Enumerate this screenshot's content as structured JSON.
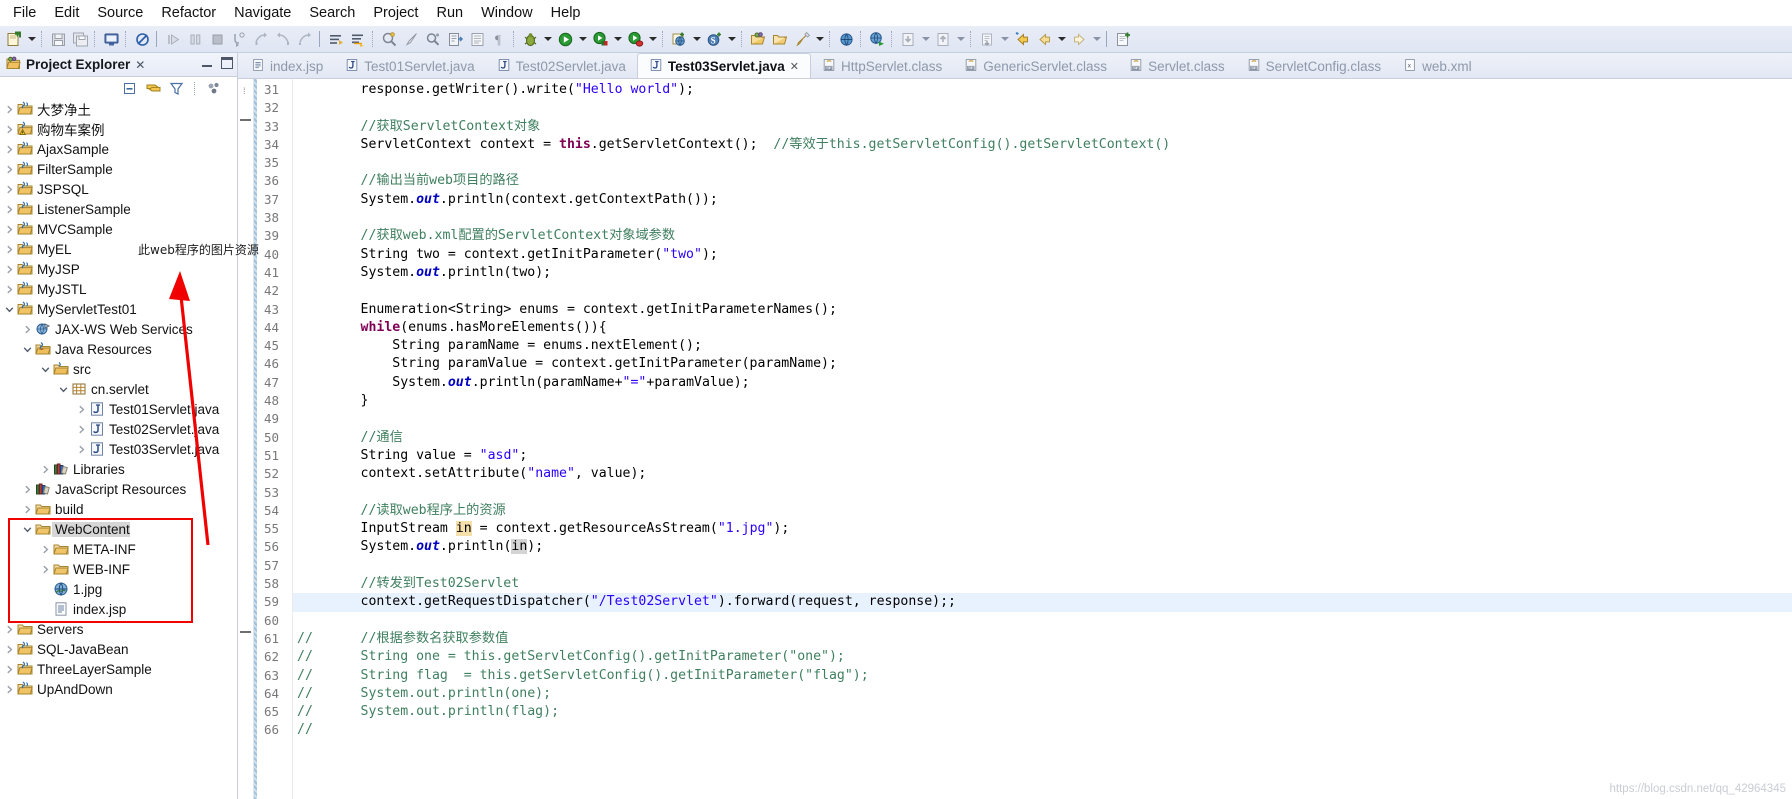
{
  "menubar": {
    "items": [
      "File",
      "Edit",
      "Source",
      "Refactor",
      "Navigate",
      "Search",
      "Project",
      "Run",
      "Window",
      "Help"
    ]
  },
  "toolbar": {
    "icons": [
      "new-file-icon",
      "new-file-dropdown-icon",
      "save-icon",
      "save-all-icon",
      "console-icon",
      "skip-breakpoints-icon",
      "resume-icon",
      "suspend-icon",
      "terminate-icon",
      "step-into-icon",
      "step-over-icon",
      "step-return-icon",
      "drop-to-frame-icon",
      "next-annotation-icon",
      "previous-annotation-icon",
      "open-type-icon",
      "brush-icon",
      "search-icon",
      "export-icon",
      "outline-icon",
      "paragraph-icon",
      "debug-icon",
      "debug-dropdown-icon",
      "run-icon",
      "run-dropdown-icon",
      "run-as-server-icon",
      "run-as-dropdown-icon",
      "profile-icon",
      "profile-dropdown-icon",
      "new-web-project-icon",
      "new-web-dropdown-icon",
      "new-spring-icon",
      "new-spring-dropdown-icon",
      "open-perspective-icon",
      "open-folder-icon",
      "pencil-icon",
      "pencil-dropdown-icon",
      "globe-icon",
      "web-browser-icon",
      "import-icon",
      "import-dropdown-icon",
      "export2-icon",
      "export2-dropdown-icon",
      "back-history-icon",
      "back-icon",
      "back-dropdown-icon",
      "forward-icon",
      "forward-dropdown-icon",
      "new-untitled-icon"
    ]
  },
  "project_explorer": {
    "title": "Project Explorer",
    "close_glyph": "✕",
    "view_tools": [
      "collapse-all-icon",
      "link-with-editor-icon",
      "view-filter-icon",
      "view-menu-icon"
    ],
    "window_buttons": [
      "minimize-button",
      "maximize-button"
    ],
    "tree": [
      {
        "label": "大梦净土",
        "indent": 0,
        "arrow": "collapsed",
        "icon": "java-web-project-icon"
      },
      {
        "label": "购物车案例",
        "indent": 0,
        "arrow": "collapsed",
        "icon": "java-web-project-warning-icon"
      },
      {
        "label": "AjaxSample",
        "indent": 0,
        "arrow": "collapsed",
        "icon": "java-web-project-icon"
      },
      {
        "label": "FilterSample",
        "indent": 0,
        "arrow": "collapsed",
        "icon": "java-web-project-icon"
      },
      {
        "label": "JSPSQL",
        "indent": 0,
        "arrow": "collapsed",
        "icon": "java-web-project-icon"
      },
      {
        "label": "ListenerSample",
        "indent": 0,
        "arrow": "collapsed",
        "icon": "java-web-project-icon"
      },
      {
        "label": "MVCSample",
        "indent": 0,
        "arrow": "collapsed",
        "icon": "java-web-project-icon"
      },
      {
        "label": "MyEL",
        "indent": 0,
        "arrow": "collapsed",
        "icon": "java-web-project-icon"
      },
      {
        "label": "MyJSP",
        "indent": 0,
        "arrow": "collapsed",
        "icon": "java-web-project-icon"
      },
      {
        "label": "MyJSTL",
        "indent": 0,
        "arrow": "collapsed",
        "icon": "java-web-project-icon"
      },
      {
        "label": "MyServletTest01",
        "indent": 0,
        "arrow": "expanded",
        "icon": "java-web-project-icon"
      },
      {
        "label": "JAX-WS Web Services",
        "indent": 1,
        "arrow": "collapsed",
        "icon": "jaxws-icon"
      },
      {
        "label": "Java Resources",
        "indent": 1,
        "arrow": "expanded",
        "icon": "java-resources-icon"
      },
      {
        "label": "src",
        "indent": 2,
        "arrow": "expanded",
        "icon": "source-folder-icon"
      },
      {
        "label": "cn.servlet",
        "indent": 3,
        "arrow": "expanded",
        "icon": "package-icon"
      },
      {
        "label": "Test01Servlet.java",
        "indent": 4,
        "arrow": "collapsed",
        "icon": "java-file-icon"
      },
      {
        "label": "Test02Servlet.java",
        "indent": 4,
        "arrow": "collapsed",
        "icon": "java-file-icon"
      },
      {
        "label": "Test03Servlet.java",
        "indent": 4,
        "arrow": "collapsed",
        "icon": "java-file-icon"
      },
      {
        "label": "Libraries",
        "indent": 2,
        "arrow": "collapsed",
        "icon": "libraries-icon"
      },
      {
        "label": "JavaScript Resources",
        "indent": 1,
        "arrow": "collapsed",
        "icon": "libraries-icon"
      },
      {
        "label": "build",
        "indent": 1,
        "arrow": "collapsed",
        "icon": "folder-icon"
      },
      {
        "label": "WebContent",
        "indent": 1,
        "arrow": "expanded",
        "icon": "folder-icon",
        "selected": true
      },
      {
        "label": "META-INF",
        "indent": 2,
        "arrow": "collapsed",
        "icon": "folder-icon"
      },
      {
        "label": "WEB-INF",
        "indent": 2,
        "arrow": "collapsed",
        "icon": "folder-icon"
      },
      {
        "label": "1.jpg",
        "indent": 2,
        "arrow": "none",
        "icon": "image-file-icon"
      },
      {
        "label": "index.jsp",
        "indent": 2,
        "arrow": "none",
        "icon": "jsp-file-icon"
      },
      {
        "label": "Servers",
        "indent": 0,
        "arrow": "collapsed",
        "icon": "folder-icon"
      },
      {
        "label": "SQL-JavaBean",
        "indent": 0,
        "arrow": "collapsed",
        "icon": "java-web-project-icon"
      },
      {
        "label": "ThreeLayerSample",
        "indent": 0,
        "arrow": "collapsed",
        "icon": "java-web-project-icon"
      },
      {
        "label": "UpAndDown",
        "indent": 0,
        "arrow": "collapsed",
        "icon": "java-web-project-icon"
      }
    ]
  },
  "editor": {
    "tabs": [
      {
        "label": "index.jsp",
        "icon": "jsp-file-icon",
        "active": false
      },
      {
        "label": "Test01Servlet.java",
        "icon": "java-file-icon",
        "active": false
      },
      {
        "label": "Test02Servlet.java",
        "icon": "java-file-icon",
        "active": false
      },
      {
        "label": "Test03Servlet.java",
        "icon": "java-file-icon",
        "active": true,
        "close_glyph": "✕"
      },
      {
        "label": "HttpServlet.class",
        "icon": "class-file-icon",
        "active": false
      },
      {
        "label": "GenericServlet.class",
        "icon": "class-file-icon",
        "active": false
      },
      {
        "label": "Servlet.class",
        "icon": "class-file-icon",
        "active": false
      },
      {
        "label": "ServletConfig.class",
        "icon": "class-file-icon",
        "active": false
      },
      {
        "label": "web.xml",
        "icon": "xml-file-icon",
        "active": false
      }
    ],
    "first_line_number": 31,
    "highlight_line": 59,
    "lines": [
      {
        "n": 31,
        "segs": [
          {
            "t": "        response.getWriter().write(",
            "c": ""
          },
          {
            "t": "\"Hello world\"",
            "c": "str"
          },
          {
            "t": ");",
            "c": ""
          }
        ]
      },
      {
        "n": 32,
        "segs": []
      },
      {
        "n": 33,
        "segs": [
          {
            "t": "        //获取ServletContext对象",
            "c": "cmt"
          }
        ]
      },
      {
        "n": 34,
        "segs": [
          {
            "t": "        ServletContext context = ",
            "c": ""
          },
          {
            "t": "this",
            "c": "kw"
          },
          {
            "t": ".getServletContext();  ",
            "c": ""
          },
          {
            "t": "//等效于this.getServletConfig().getServletContext()",
            "c": "cmt"
          }
        ]
      },
      {
        "n": 35,
        "segs": []
      },
      {
        "n": 36,
        "segs": [
          {
            "t": "        //输出当前web项目的路径",
            "c": "cmt"
          }
        ]
      },
      {
        "n": 37,
        "segs": [
          {
            "t": "        System.",
            "c": ""
          },
          {
            "t": "out",
            "c": "fld"
          },
          {
            "t": ".println(context.getContextPath());",
            "c": ""
          }
        ]
      },
      {
        "n": 38,
        "segs": []
      },
      {
        "n": 39,
        "segs": [
          {
            "t": "        //获取web.xml配置的ServletContext对象域参数",
            "c": "cmt"
          }
        ]
      },
      {
        "n": 40,
        "segs": [
          {
            "t": "        String two = context.getInitParameter(",
            "c": ""
          },
          {
            "t": "\"two\"",
            "c": "str"
          },
          {
            "t": ");",
            "c": ""
          }
        ]
      },
      {
        "n": 41,
        "segs": [
          {
            "t": "        System.",
            "c": ""
          },
          {
            "t": "out",
            "c": "fld"
          },
          {
            "t": ".println(two);",
            "c": ""
          }
        ]
      },
      {
        "n": 42,
        "segs": []
      },
      {
        "n": 43,
        "segs": [
          {
            "t": "        Enumeration<String> enums = context.getInitParameterNames();",
            "c": ""
          }
        ]
      },
      {
        "n": 44,
        "segs": [
          {
            "t": "        ",
            "c": ""
          },
          {
            "t": "while",
            "c": "kw"
          },
          {
            "t": "(enums.hasMoreElements()){",
            "c": ""
          }
        ]
      },
      {
        "n": 45,
        "segs": [
          {
            "t": "            String paramName = enums.nextElement();",
            "c": ""
          }
        ]
      },
      {
        "n": 46,
        "segs": [
          {
            "t": "            String paramValue = context.getInitParameter(paramName);",
            "c": ""
          }
        ]
      },
      {
        "n": 47,
        "segs": [
          {
            "t": "            System.",
            "c": ""
          },
          {
            "t": "out",
            "c": "fld"
          },
          {
            "t": ".println(paramName+",
            "c": ""
          },
          {
            "t": "\"=\"",
            "c": "str"
          },
          {
            "t": "+paramValue);",
            "c": ""
          }
        ]
      },
      {
        "n": 48,
        "segs": [
          {
            "t": "        }",
            "c": ""
          }
        ]
      },
      {
        "n": 49,
        "segs": []
      },
      {
        "n": 50,
        "segs": [
          {
            "t": "        //通信",
            "c": "cmt"
          }
        ]
      },
      {
        "n": 51,
        "segs": [
          {
            "t": "        String value = ",
            "c": ""
          },
          {
            "t": "\"asd\"",
            "c": "str"
          },
          {
            "t": ";",
            "c": ""
          }
        ]
      },
      {
        "n": 52,
        "segs": [
          {
            "t": "        context.setAttribute(",
            "c": ""
          },
          {
            "t": "\"name\"",
            "c": "str"
          },
          {
            "t": ", value);",
            "c": ""
          }
        ]
      },
      {
        "n": 53,
        "segs": []
      },
      {
        "n": 54,
        "segs": [
          {
            "t": "        //读取web程序上的资源",
            "c": "cmt"
          }
        ]
      },
      {
        "n": 55,
        "segs": [
          {
            "t": "        InputStream ",
            "c": ""
          },
          {
            "t": "in",
            "c": "occ"
          },
          {
            "t": " = context.getResourceAsStream(",
            "c": ""
          },
          {
            "t": "\"1.jpg\"",
            "c": "str"
          },
          {
            "t": ");",
            "c": ""
          }
        ]
      },
      {
        "n": 56,
        "segs": [
          {
            "t": "        System.",
            "c": ""
          },
          {
            "t": "out",
            "c": "fld"
          },
          {
            "t": ".println(",
            "c": ""
          },
          {
            "t": "in",
            "c": "occ2"
          },
          {
            "t": ");",
            "c": ""
          }
        ]
      },
      {
        "n": 57,
        "segs": []
      },
      {
        "n": 58,
        "segs": [
          {
            "t": "        //转发到Test02Servlet",
            "c": "cmt"
          }
        ]
      },
      {
        "n": 59,
        "segs": [
          {
            "t": "        context.getRequestDispatcher(",
            "c": ""
          },
          {
            "t": "\"/Test02Servlet\"",
            "c": "str"
          },
          {
            "t": ").forward(request, response);;",
            "c": ""
          }
        ]
      },
      {
        "n": 60,
        "segs": []
      },
      {
        "n": 61,
        "segs": [
          {
            "t": "//      //根据参数名获取参数值",
            "c": "cmt"
          }
        ]
      },
      {
        "n": 62,
        "segs": [
          {
            "t": "//      String one = this.getServletConfig().getInitParameter(\"one\");",
            "c": "cmt"
          }
        ]
      },
      {
        "n": 63,
        "segs": [
          {
            "t": "//      String flag  = this.getServletConfig().getInitParameter(\"flag\");",
            "c": "cmt"
          }
        ]
      },
      {
        "n": 64,
        "segs": [
          {
            "t": "//      System.out.println(one);",
            "c": "cmt"
          }
        ]
      },
      {
        "n": 65,
        "segs": [
          {
            "t": "//      System.out.println(flag);",
            "c": "cmt"
          }
        ]
      },
      {
        "n": 66,
        "segs": [
          {
            "t": "//",
            "c": "cmt"
          }
        ]
      }
    ]
  },
  "annotations": {
    "note_text": "此web程序的图片资源",
    "arrow_color": "#f10000",
    "box_color": "#f10000"
  },
  "watermark": {
    "text": "https://blog.csdn.net/qq_42964345"
  }
}
